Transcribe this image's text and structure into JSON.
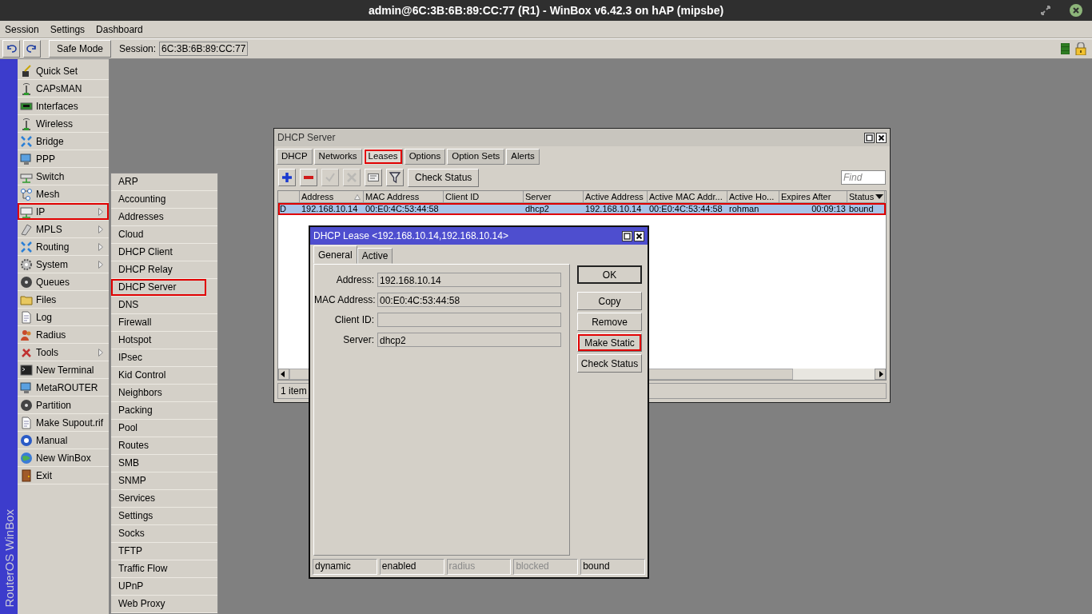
{
  "window": {
    "title": "admin@6C:3B:6B:89:CC:77 (R1) - WinBox v6.42.3 on hAP (mipsbe)"
  },
  "menu": [
    "Session",
    "Settings",
    "Dashboard"
  ],
  "toolbar": {
    "safe_mode": "Safe Mode",
    "session_label": "Session:",
    "session_value": "6C:3B:6B:89:CC:77"
  },
  "brand": "RouterOS WinBox",
  "sidebar": {
    "items": [
      {
        "label": "Quick Set",
        "has_submenu": false,
        "highlighted": false
      },
      {
        "label": "CAPsMAN",
        "has_submenu": false,
        "highlighted": false
      },
      {
        "label": "Interfaces",
        "has_submenu": false,
        "highlighted": false
      },
      {
        "label": "Wireless",
        "has_submenu": false,
        "highlighted": false
      },
      {
        "label": "Bridge",
        "has_submenu": false,
        "highlighted": false
      },
      {
        "label": "PPP",
        "has_submenu": false,
        "highlighted": false
      },
      {
        "label": "Switch",
        "has_submenu": false,
        "highlighted": false
      },
      {
        "label": "Mesh",
        "has_submenu": false,
        "highlighted": false
      },
      {
        "label": "IP",
        "has_submenu": true,
        "highlighted": true
      },
      {
        "label": "MPLS",
        "has_submenu": true,
        "highlighted": false
      },
      {
        "label": "Routing",
        "has_submenu": true,
        "highlighted": false
      },
      {
        "label": "System",
        "has_submenu": true,
        "highlighted": false
      },
      {
        "label": "Queues",
        "has_submenu": false,
        "highlighted": false
      },
      {
        "label": "Files",
        "has_submenu": false,
        "highlighted": false
      },
      {
        "label": "Log",
        "has_submenu": false,
        "highlighted": false
      },
      {
        "label": "Radius",
        "has_submenu": false,
        "highlighted": false
      },
      {
        "label": "Tools",
        "has_submenu": true,
        "highlighted": false
      },
      {
        "label": "New Terminal",
        "has_submenu": false,
        "highlighted": false
      },
      {
        "label": "MetaROUTER",
        "has_submenu": false,
        "highlighted": false
      },
      {
        "label": "Partition",
        "has_submenu": false,
        "highlighted": false
      },
      {
        "label": "Make Supout.rif",
        "has_submenu": false,
        "highlighted": false
      },
      {
        "label": "Manual",
        "has_submenu": false,
        "highlighted": false
      },
      {
        "label": "New WinBox",
        "has_submenu": false,
        "highlighted": false
      },
      {
        "label": "Exit",
        "has_submenu": false,
        "highlighted": false
      }
    ]
  },
  "submenu": {
    "items": [
      {
        "label": "ARP",
        "highlighted": false
      },
      {
        "label": "Accounting",
        "highlighted": false
      },
      {
        "label": "Addresses",
        "highlighted": false
      },
      {
        "label": "Cloud",
        "highlighted": false
      },
      {
        "label": "DHCP Client",
        "highlighted": false
      },
      {
        "label": "DHCP Relay",
        "highlighted": false
      },
      {
        "label": "DHCP Server",
        "highlighted": true
      },
      {
        "label": "DNS",
        "highlighted": false
      },
      {
        "label": "Firewall",
        "highlighted": false
      },
      {
        "label": "Hotspot",
        "highlighted": false
      },
      {
        "label": "IPsec",
        "highlighted": false
      },
      {
        "label": "Kid Control",
        "highlighted": false
      },
      {
        "label": "Neighbors",
        "highlighted": false
      },
      {
        "label": "Packing",
        "highlighted": false
      },
      {
        "label": "Pool",
        "highlighted": false
      },
      {
        "label": "Routes",
        "highlighted": false
      },
      {
        "label": "SMB",
        "highlighted": false
      },
      {
        "label": "SNMP",
        "highlighted": false
      },
      {
        "label": "Services",
        "highlighted": false
      },
      {
        "label": "Settings",
        "highlighted": false
      },
      {
        "label": "Socks",
        "highlighted": false
      },
      {
        "label": "TFTP",
        "highlighted": false
      },
      {
        "label": "Traffic Flow",
        "highlighted": false
      },
      {
        "label": "UPnP",
        "highlighted": false
      },
      {
        "label": "Web Proxy",
        "highlighted": false
      }
    ]
  },
  "server_window": {
    "title": "DHCP Server",
    "tabs": [
      {
        "label": "DHCP",
        "selected": false,
        "highlighted": false
      },
      {
        "label": "Networks",
        "selected": false,
        "highlighted": false
      },
      {
        "label": "Leases",
        "selected": true,
        "highlighted": true
      },
      {
        "label": "Options",
        "selected": false,
        "highlighted": false
      },
      {
        "label": "Option Sets",
        "selected": false,
        "highlighted": false
      },
      {
        "label": "Alerts",
        "selected": false,
        "highlighted": false
      }
    ],
    "tools": [
      {
        "kind": "add",
        "disabled": false
      },
      {
        "kind": "remove",
        "disabled": false
      },
      {
        "kind": "enable",
        "disabled": true
      },
      {
        "kind": "disable",
        "disabled": true
      },
      {
        "kind": "comment",
        "disabled": false
      },
      {
        "kind": "filter",
        "disabled": false
      }
    ],
    "check_status": "Check Status",
    "find": {
      "placeholder": "Find"
    },
    "columns": [
      {
        "label": "Address",
        "sorted": true
      },
      {
        "label": "MAC Address",
        "sorted": false
      },
      {
        "label": "Client ID",
        "sorted": false
      },
      {
        "label": "Server",
        "sorted": false
      },
      {
        "label": "Active Address",
        "sorted": false
      },
      {
        "label": "Active MAC Addr...",
        "sorted": false
      },
      {
        "label": "Active Ho...",
        "sorted": false
      },
      {
        "label": "Expires After",
        "sorted": false
      },
      {
        "label": "Status",
        "sorted": false
      }
    ],
    "rows": [
      {
        "flag": "D",
        "address": "192.168.10.14",
        "mac": "00:E0:4C:53:44:58",
        "server": "dhcp2",
        "active_address": "192.168.10.14",
        "active_mac": "00:E0:4C:53:44:58",
        "active_host": "rohman",
        "expires": "00:09:13",
        "status": "bound",
        "selected": true,
        "highlighted": true
      }
    ],
    "status": "1 item"
  },
  "lease_window": {
    "title": "DHCP Lease <192.168.10.14,192.168.10.14>",
    "tabs": [
      {
        "label": "General",
        "selected": true
      },
      {
        "label": "Active",
        "selected": false
      }
    ],
    "fields": [
      {
        "label": "Address:",
        "value": "192.168.10.14"
      },
      {
        "label": "MAC Address:",
        "value": "00:E0:4C:53:44:58"
      },
      {
        "label": "Client ID:"
      },
      {
        "label": "Server:",
        "value": "dhcp2"
      }
    ],
    "buttons": [
      {
        "label": "OK",
        "highlighted": false
      },
      {
        "label": "Copy",
        "highlighted": false
      },
      {
        "label": "Remove",
        "highlighted": false
      },
      {
        "label": "Make Static",
        "highlighted": true
      },
      {
        "label": "Check Status",
        "highlighted": false
      }
    ],
    "status": [
      {
        "label": "dynamic",
        "disabled": false
      },
      {
        "label": "enabled",
        "disabled": false
      },
      {
        "label": "radius",
        "disabled": true
      },
      {
        "label": "blocked",
        "disabled": true
      },
      {
        "label": "bound",
        "disabled": false
      }
    ]
  }
}
